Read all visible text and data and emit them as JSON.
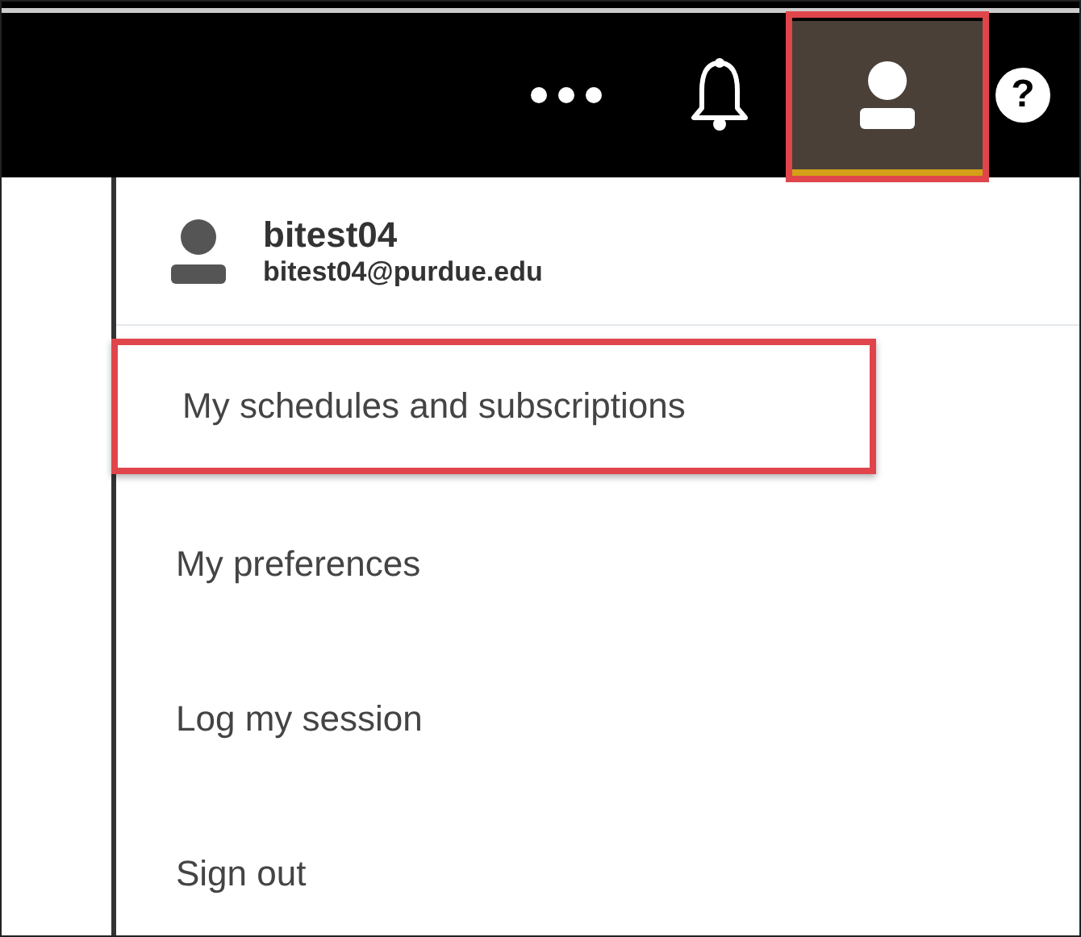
{
  "top_bar": {
    "buttons": [
      {
        "kind": "more",
        "selected": false,
        "highlighted": false
      },
      {
        "kind": "bell",
        "selected": false,
        "highlighted": false
      },
      {
        "kind": "user",
        "selected": true,
        "highlighted": true
      },
      {
        "kind": "help",
        "label": "?",
        "selected": false,
        "highlighted": false
      }
    ]
  },
  "account_menu": {
    "user": {
      "name": "bitest04",
      "email": "bitest04@purdue.edu"
    },
    "items": [
      {
        "label": "My schedules and subscriptions",
        "highlighted": true
      },
      {
        "label": "My preferences",
        "highlighted": false
      },
      {
        "label": "Log my session",
        "highlighted": false
      },
      {
        "label": "Sign out",
        "highlighted": false
      }
    ]
  }
}
